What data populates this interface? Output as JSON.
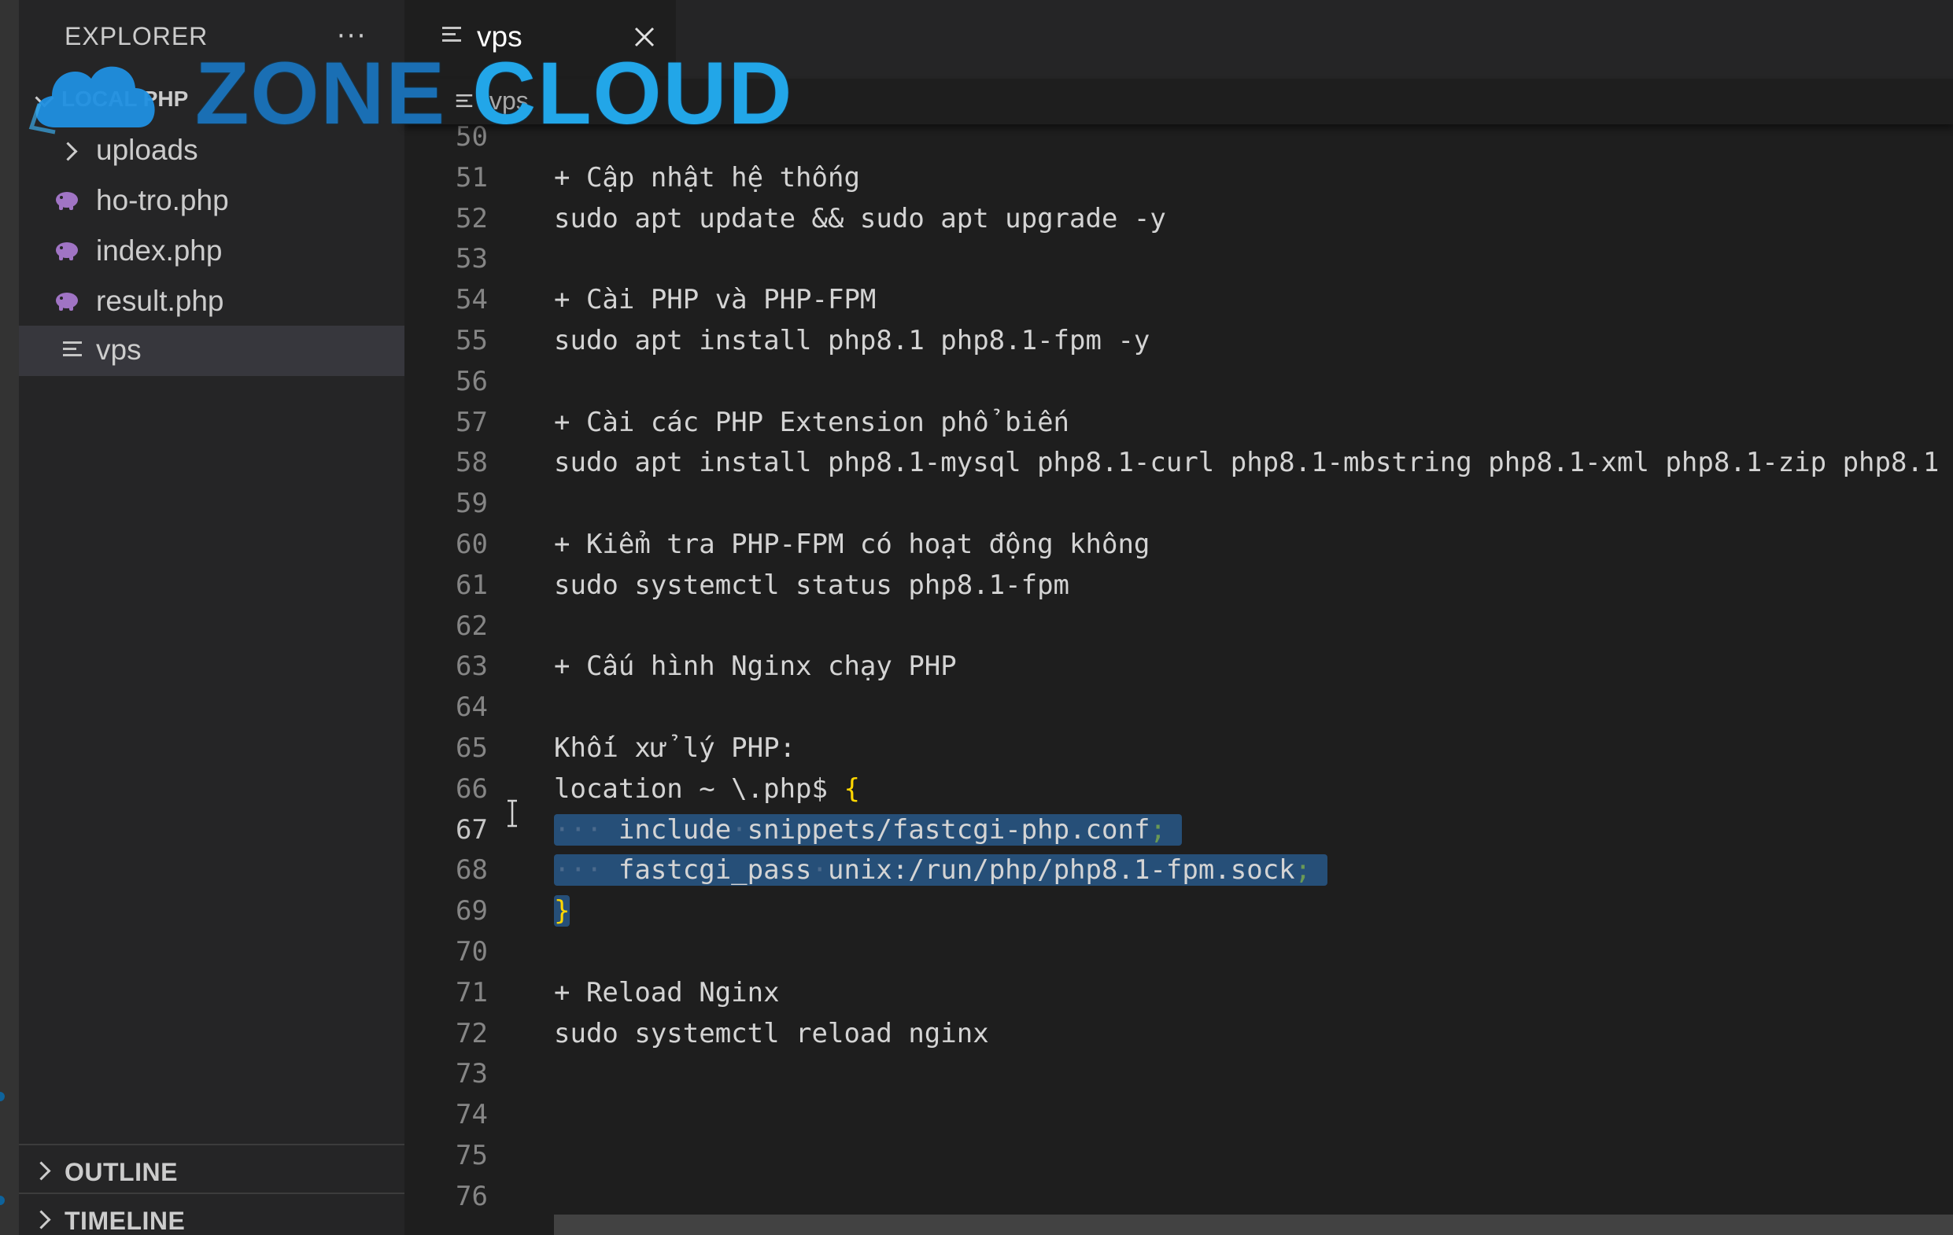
{
  "sidebar": {
    "header": "EXPLORER",
    "more": "···",
    "folder": "LOCAL PHP",
    "items": [
      {
        "label": "uploads",
        "type": "folder"
      },
      {
        "label": "ho-tro.php",
        "type": "php"
      },
      {
        "label": "index.php",
        "type": "php"
      },
      {
        "label": "result.php",
        "type": "php"
      },
      {
        "label": "vps",
        "type": "text",
        "selected": true
      }
    ],
    "sections": [
      {
        "label": "OUTLINE"
      },
      {
        "label": "TIMELINE"
      }
    ]
  },
  "tab": {
    "label": "vps"
  },
  "breadcrumb": {
    "label": "vps"
  },
  "watermark": {
    "word1": "ZONE",
    "word2": "CLOUD"
  },
  "editor": {
    "active_line": "67",
    "lines": [
      {
        "n": "50",
        "text": ""
      },
      {
        "n": "51",
        "text": "+ Cập nhật hệ thống"
      },
      {
        "n": "52",
        "text": "sudo apt update && sudo apt upgrade -y"
      },
      {
        "n": "53",
        "text": ""
      },
      {
        "n": "54",
        "text": "+ Cài PHP và PHP-FPM"
      },
      {
        "n": "55",
        "text": "sudo apt install php8.1 php8.1-fpm -y"
      },
      {
        "n": "56",
        "text": ""
      },
      {
        "n": "57",
        "text": "+ Cài các PHP Extension phổ biến"
      },
      {
        "n": "58",
        "text": "sudo apt install php8.1-mysql php8.1-curl php8.1-mbstring php8.1-xml php8.1-zip php8.1"
      },
      {
        "n": "59",
        "text": ""
      },
      {
        "n": "60",
        "text": "+ Kiểm tra PHP-FPM có hoạt động không"
      },
      {
        "n": "61",
        "text": "sudo systemctl status php8.1-fpm"
      },
      {
        "n": "62",
        "text": ""
      },
      {
        "n": "63",
        "text": "+ Cấu hình Nginx chạy PHP"
      },
      {
        "n": "64",
        "text": ""
      },
      {
        "n": "65",
        "text": "Khối xử lý PHP:"
      },
      {
        "n": "66",
        "text": "location ~ \\.php$ {"
      },
      {
        "n": "67",
        "text": "    include snippets/fastcgi-php.conf;"
      },
      {
        "n": "68",
        "text": "    fastcgi_pass unix:/run/php/php8.1-fpm.sock;"
      },
      {
        "n": "69",
        "text": "}"
      },
      {
        "n": "70",
        "text": ""
      },
      {
        "n": "71",
        "text": "+ Reload Nginx"
      },
      {
        "n": "72",
        "text": "sudo systemctl reload nginx"
      },
      {
        "n": "73",
        "text": ""
      },
      {
        "n": "74",
        "text": ""
      },
      {
        "n": "75",
        "text": ""
      },
      {
        "n": "76",
        "text": ""
      }
    ]
  },
  "colors": {
    "selection": "#264f78",
    "brace": "#ffd700",
    "text": "#d4d4d4",
    "line_number": "#858585"
  }
}
